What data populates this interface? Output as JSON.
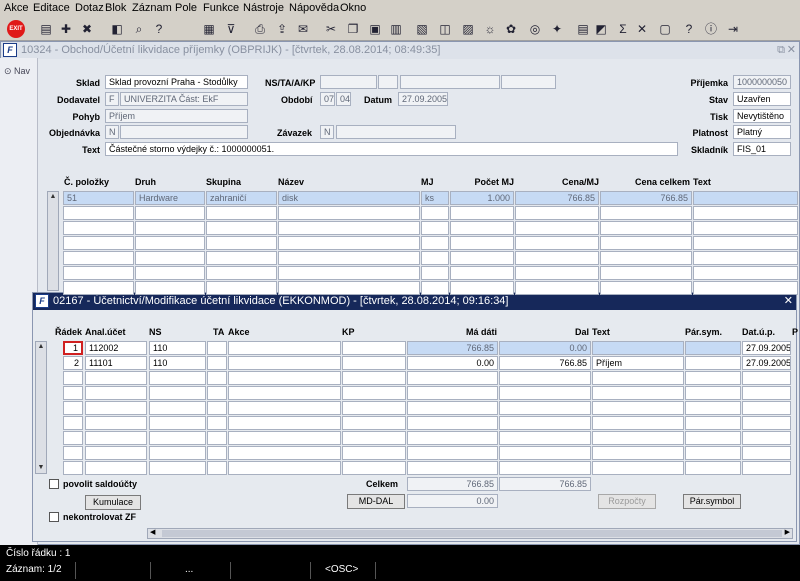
{
  "menu": [
    "Akce",
    "Editace",
    "Dotaz",
    "Blok",
    "Záznam",
    "Pole",
    "Funkce",
    "Nástroje",
    "Nápověda",
    "Okno"
  ],
  "toolbar_icons": [
    "exit-icon",
    "save-icon",
    "add-record-icon",
    "delete-record-icon",
    "clear-icon",
    "search-icon",
    "query-icon",
    "run-query-icon",
    "filter-icon",
    "print-icon",
    "export-icon",
    "mail-icon",
    "cut-icon",
    "copy-icon",
    "paste-icon",
    "calculator-icon",
    "settings-icon",
    "tools-icon",
    "help-icon",
    "note-icon",
    "report-icon",
    "chart-icon",
    "sigma-icon",
    "excel-icon",
    "window-icon",
    "question-icon",
    "info-icon",
    "exit-icon"
  ],
  "sidebar": {
    "nav": "Nav"
  },
  "win1": {
    "title": "10324 - Obchod/Účetní likvidace příjemky (OBPRIJK) - [čtvrtek, 28.08.2014; 08:49:35]",
    "labels": {
      "sklad": "Sklad",
      "dodavatel": "Dodavatel",
      "pohyb": "Pohyb",
      "objednavka": "Objednávka",
      "text": "Text",
      "nstakp": "NS/TA/A/KP",
      "obdobi": "Období",
      "datum": "Datum",
      "zavazek": "Závazek",
      "prijemka": "Příjemka",
      "stav": "Stav",
      "tisk": "Tisk",
      "platnost": "Platnost",
      "skladnik": "Skladník"
    },
    "values": {
      "sklad": "Sklad provozní Praha - Stodůlky",
      "dodavatel_f": "F",
      "dodavatel": "UNIVERZITA Část: EkF",
      "pohyb": "Příjem",
      "objednavka": "N",
      "text": "Částečné storno výdejky č.: 1000000051.",
      "obdobi_1": "07",
      "obdobi_2": "04",
      "datum": "27.09.2005",
      "zavazek": "N",
      "prijemka": "1000000050",
      "stav": "Uzavřen",
      "tisk": "Nevytištěno",
      "platnost": "Platný",
      "skladnik": "FIS_01"
    },
    "columns": [
      "Č. položky",
      "Druh",
      "Skupina",
      "Název",
      "MJ",
      "Počet MJ",
      "Cena/MJ",
      "Cena celkem",
      "Text"
    ],
    "row": {
      "cislo": "51",
      "druh": "Hardware",
      "skupina": "zahraničí",
      "nazev": "disk",
      "mj": "ks",
      "pocet": "1.000",
      "cena": "766.85",
      "celkem": "766.85"
    }
  },
  "win2": {
    "title": "02167 - Účetnictví/Modifikace účetní likvidace (EKKONMOD) - [čtvrtek, 28.08.2014; 09:16:34]",
    "columns": [
      "Řádek",
      "Anal.účet",
      "NS",
      "TA",
      "Akce",
      "KP",
      "Má dáti",
      "Dal",
      "Text",
      "Pár.sym.",
      "Dat.ú.p.",
      "P"
    ],
    "rows": [
      {
        "radek": "1",
        "ucet": "112002",
        "ns": "110",
        "madati": "766.85",
        "dal": "0.00",
        "text": "",
        "datum": "27.09.2005"
      },
      {
        "radek": "2",
        "ucet": "11101",
        "ns": "110",
        "madati": "0.00",
        "dal": "766.85",
        "text": "Příjem",
        "datum": "27.09.2005"
      }
    ],
    "povolit": "povolit saldoúčty",
    "kumulace": "Kumulace",
    "nekontrolovat": "nekontrolovat ZF",
    "celkem_label": "Celkem",
    "celkem_madati": "766.85",
    "celkem_dal": "766.85",
    "mddal_label": "MD-DAL",
    "mddal_value": "0.00",
    "rozpocty": "Rozpočty",
    "parsymbol": "Pár.symbol"
  },
  "status": {
    "line1": "Číslo řádku : 1",
    "line2": "Záznam: 1/2",
    "dots": "...",
    "osc": "<OSC>"
  }
}
